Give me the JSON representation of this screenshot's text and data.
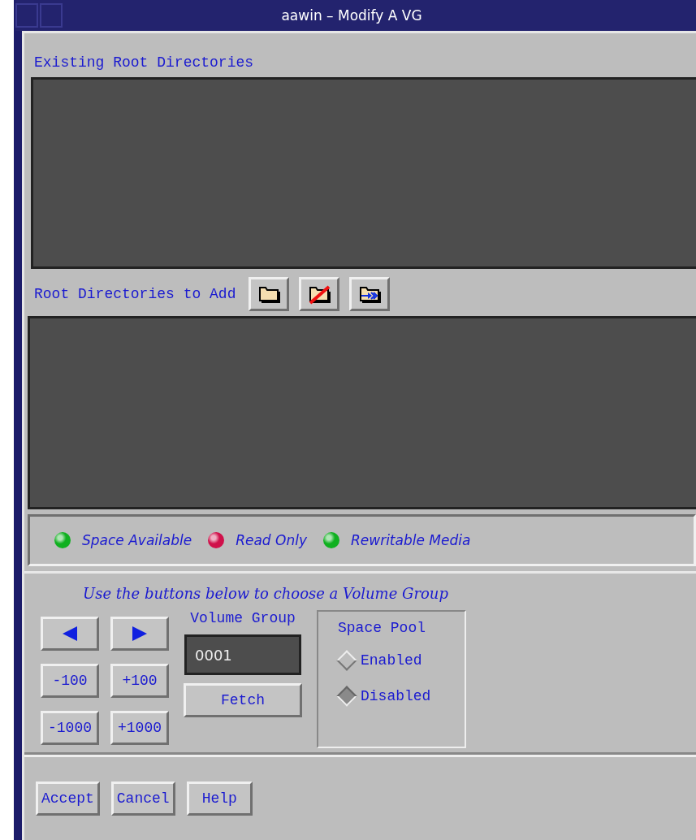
{
  "window": {
    "title": "aawin – Modify A VG"
  },
  "existing": {
    "label": "Existing Root Directories"
  },
  "to_add": {
    "label": "Root Directories to Add",
    "tools": [
      {
        "kind": "folder"
      },
      {
        "kind": "no-folder"
      },
      {
        "kind": "import-folder"
      }
    ]
  },
  "legend": [
    {
      "label": "Space Available",
      "color": "#10b020"
    },
    {
      "label": "Read Only",
      "color": "#d0104a"
    },
    {
      "label": "Rewritable Media",
      "color": "#10b020"
    }
  ],
  "hint": "Use the buttons below to choose a Volume Group",
  "steppers": [
    {
      "kind": "arrow-left"
    },
    {
      "kind": "arrow-right"
    },
    {
      "kind": "text",
      "label": "-100"
    },
    {
      "kind": "text",
      "label": "+100"
    },
    {
      "kind": "text",
      "label": "-1000"
    },
    {
      "kind": "text",
      "label": "+1000"
    }
  ],
  "volume_group": {
    "label": "Volume Group",
    "value": "0001",
    "button": "Fetch"
  },
  "space_pool": {
    "label": "Space Pool",
    "options": [
      {
        "label": "Enabled",
        "selected": false
      },
      {
        "label": "Disabled",
        "selected": true
      }
    ]
  },
  "buttons": [
    "Accept",
    "Cancel",
    "Help"
  ]
}
